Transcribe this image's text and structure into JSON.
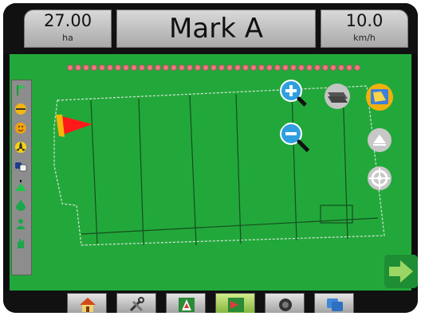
{
  "header": {
    "left_value": "27.00",
    "left_unit": "ha",
    "title": "Mark A",
    "right_value": "10.0",
    "right_unit": "km/h"
  },
  "colors": {
    "field": "#22a83a",
    "boundary": "#cfd8cf",
    "marker_red": "#ff1a1a",
    "marker_yellow": "#f3b70b"
  },
  "icons": {
    "left_bar": [
      "flag-icon",
      "level-icon",
      "smile-icon",
      "radiation-icon",
      "link-icon",
      "warning-icon",
      "drop-icon",
      "person-icon"
    ],
    "map_controls": [
      "zoom-in-icon",
      "zoom-out-icon",
      "layers-icon",
      "map-view-icon",
      "tilt-icon",
      "target-icon"
    ],
    "bottom_tabs": [
      "home-icon",
      "tools-icon",
      "guidance-icon",
      "map-icon",
      "circle-icon",
      "screens-icon"
    ]
  },
  "selected_tab": "map"
}
